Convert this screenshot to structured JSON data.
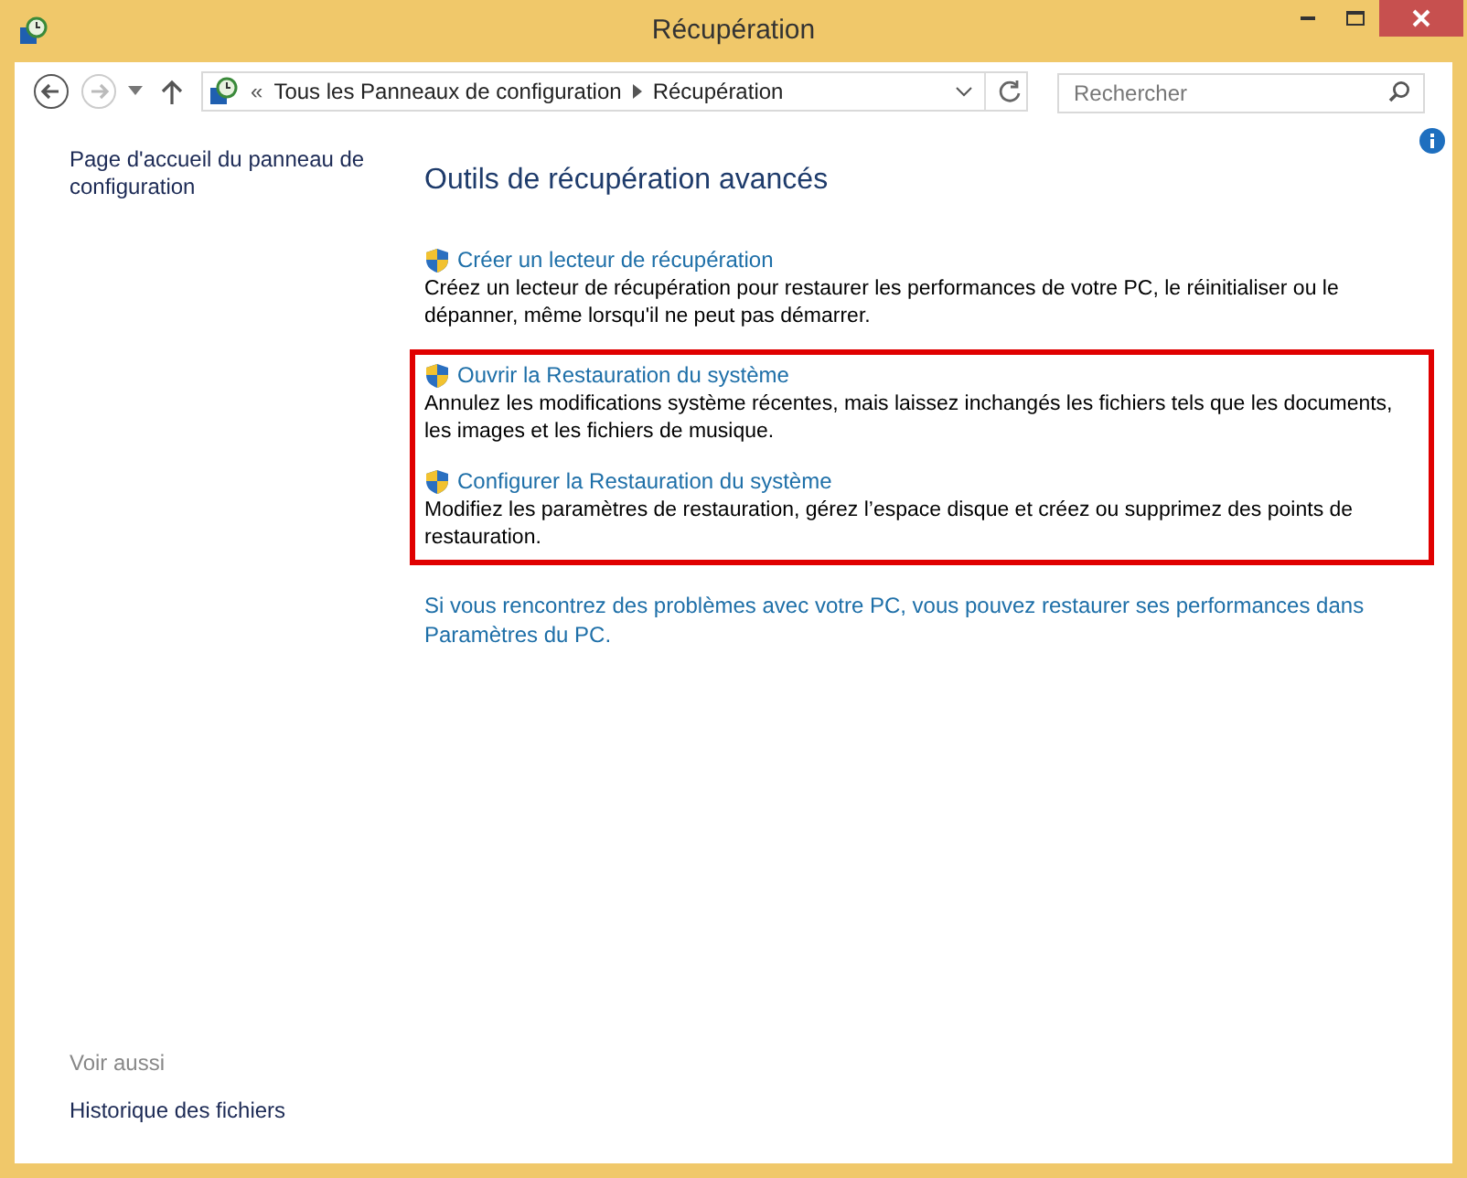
{
  "window": {
    "title": "Récupération"
  },
  "address_bar": {
    "breadcrumb": [
      "Tous les Panneaux de configuration",
      "Récupération"
    ],
    "overflow": "«"
  },
  "search": {
    "placeholder": "Rechercher"
  },
  "sidebar": {
    "home_link": "Page d'accueil du panneau de configuration",
    "see_also_title": "Voir aussi",
    "see_also_links": [
      "Historique des fichiers"
    ]
  },
  "heading": "Outils de récupération avancés",
  "tasks": [
    {
      "title": "Créer un lecteur de récupération",
      "description": "Créez un lecteur de récupération pour restaurer les performances de votre PC, le réinitialiser ou le dépanner, même lorsqu'il ne peut pas démarrer.",
      "highlighted": false
    },
    {
      "title": "Ouvrir la Restauration du système",
      "description": "Annulez les modifications système récentes, mais laissez inchangés les fichiers tels que les documents, les images et les fichiers de musique.",
      "highlighted": true
    },
    {
      "title": "Configurer la Restauration du système",
      "description": "Modifiez les paramètres de restauration, gérez l’espace disque et créez ou supprimez des points de restauration.",
      "highlighted": true
    }
  ],
  "footer_link": "Si vous rencontrez des problèmes avec votre PC, vous pouvez restaurer ses performances dans Paramètres du PC."
}
